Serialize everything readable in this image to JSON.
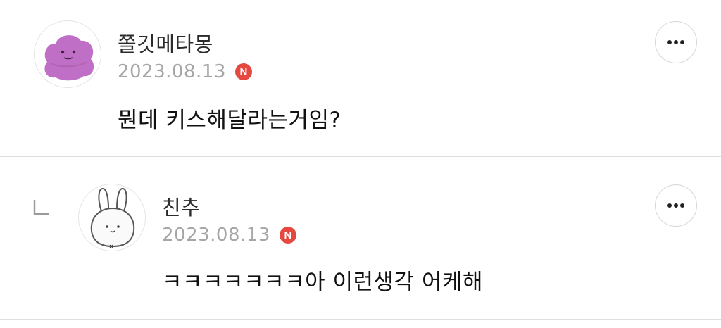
{
  "comments": [
    {
      "username": "쫄깃메타몽",
      "date": "2023.08.13",
      "badge": "N",
      "text": "뭔데 키스해달라는거임?",
      "avatar_icon": "ditto-avatar-icon",
      "more_icon": "more-options-icon"
    },
    {
      "username": "친추",
      "date": "2023.08.13",
      "badge": "N",
      "text": "ㅋㅋㅋㅋㅋㅋㅋ아 이런생각 어케해",
      "avatar_icon": "rabbit-avatar-icon",
      "more_icon": "more-options-icon",
      "reply_icon": "reply-arrow-icon"
    }
  ],
  "colors": {
    "badge": "#e5483f",
    "date": "#a6a6a6",
    "divider": "#dedede",
    "avatar_ditto": "#c06fc6"
  }
}
